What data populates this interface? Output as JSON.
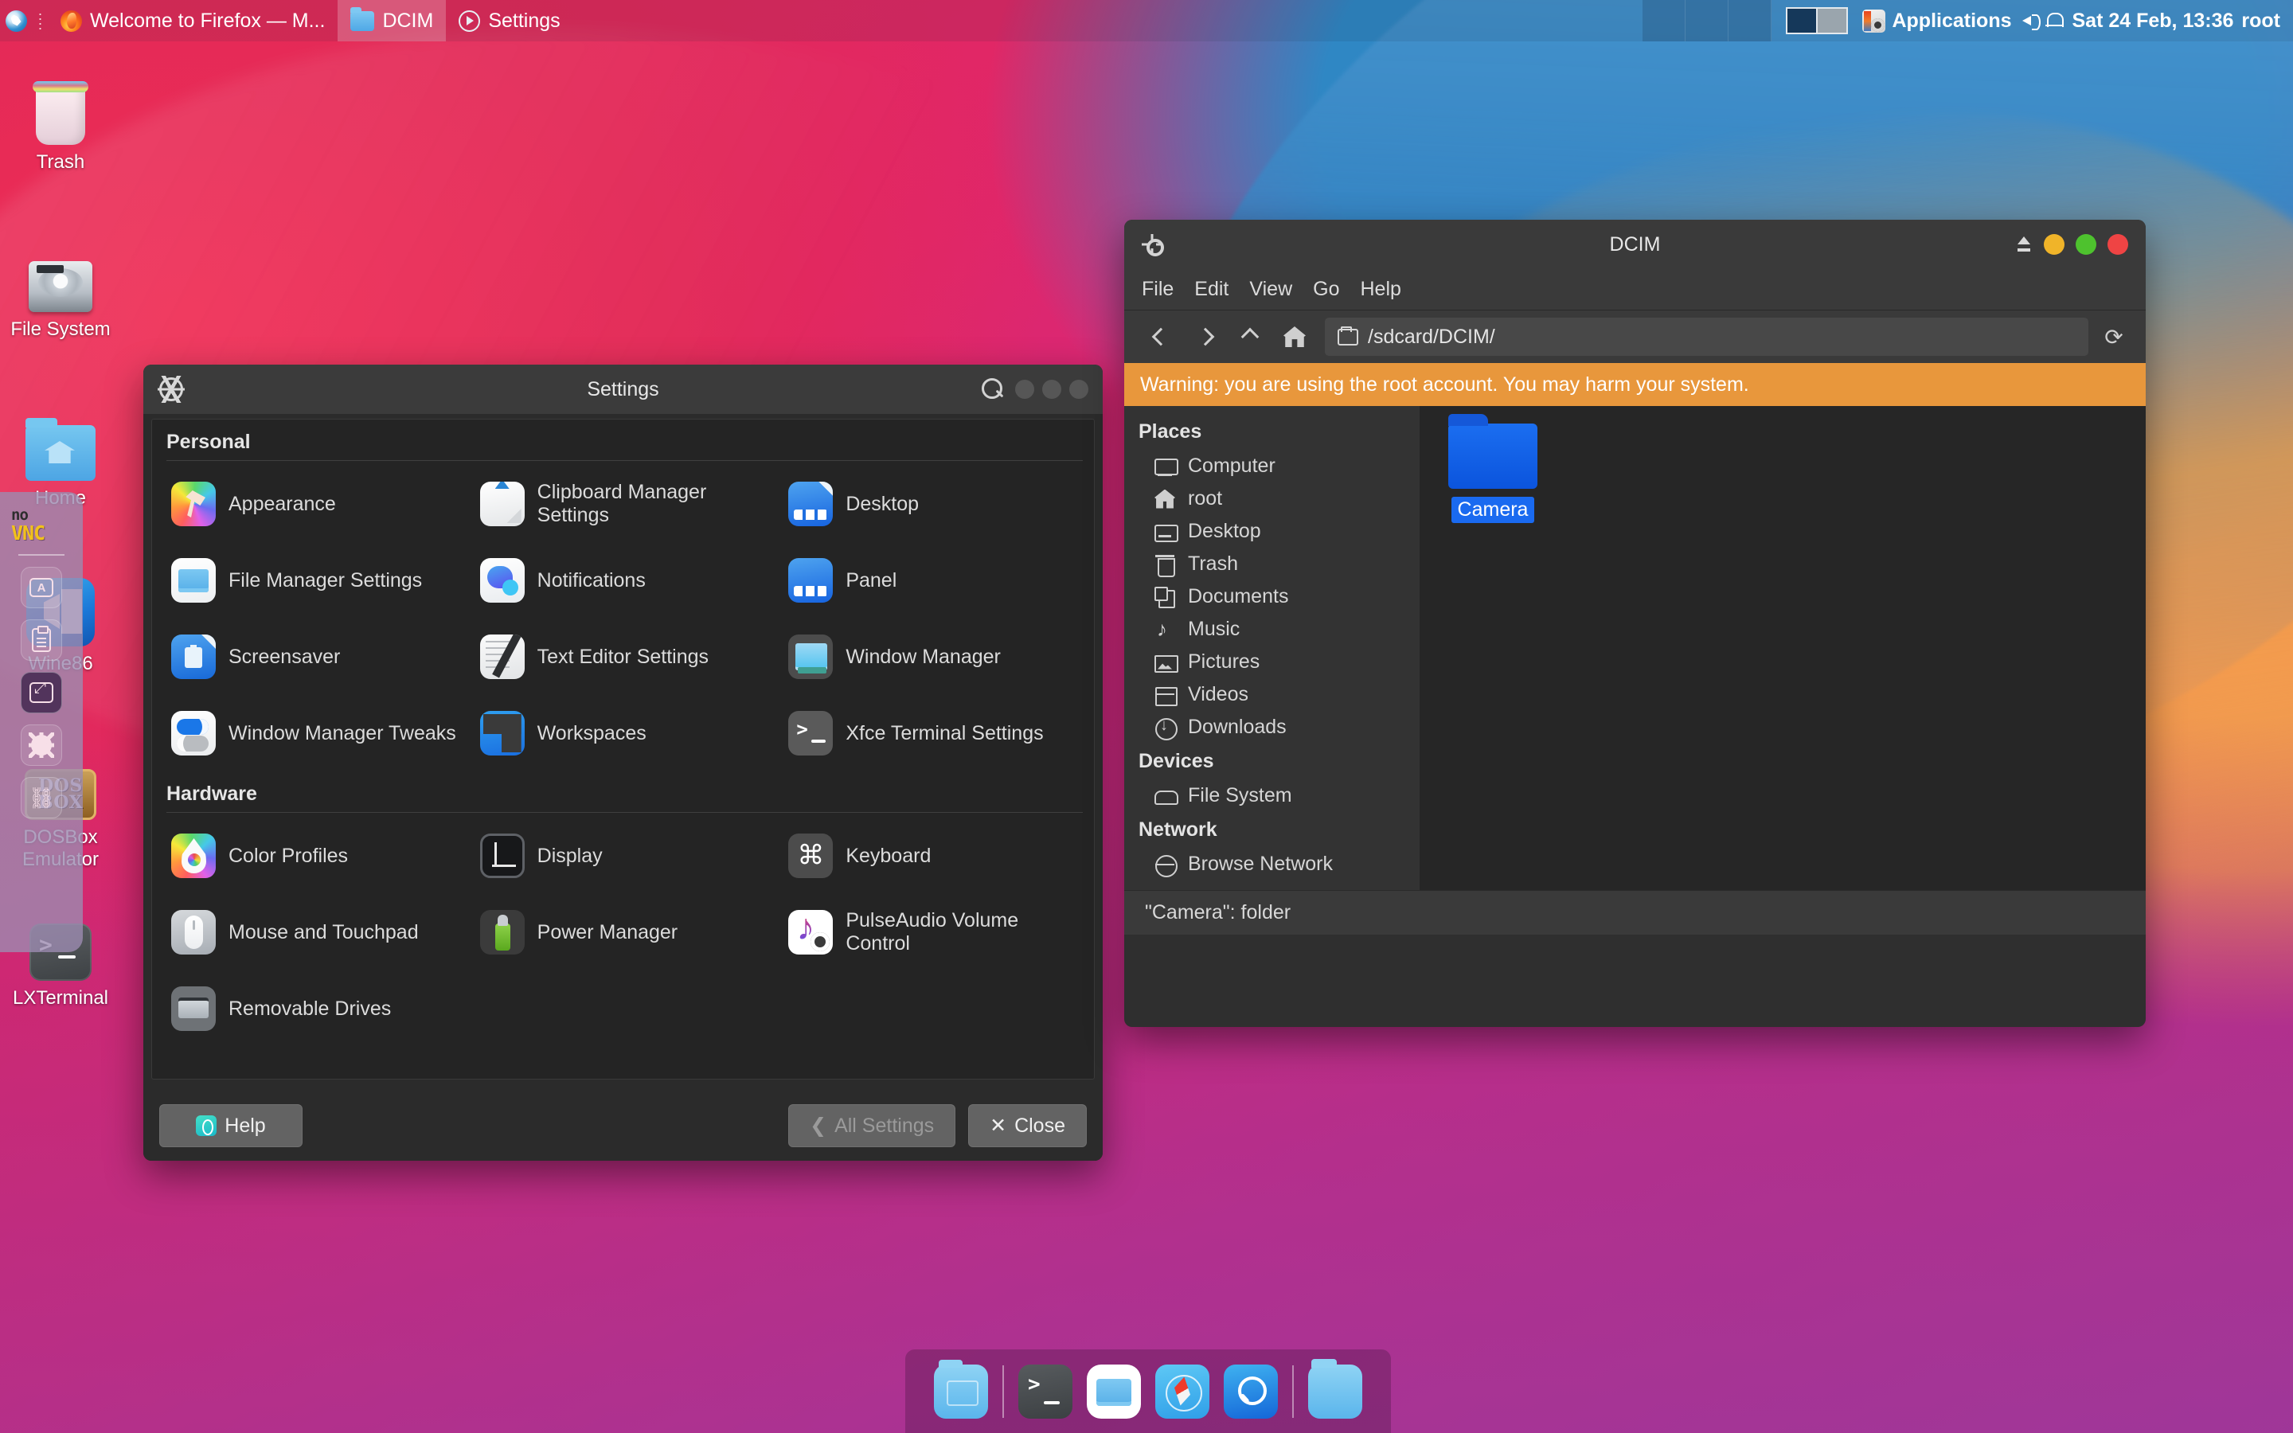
{
  "panel": {
    "whisker_icon": "xfce-whisker-menu-icon",
    "grip_icon": "panel-grip-icon",
    "tasks": [
      {
        "label": "Welcome to Firefox — M...",
        "icon": "firefox-icon",
        "active": false
      },
      {
        "label": "DCIM",
        "icon": "folder-icon",
        "active": true
      },
      {
        "label": "Settings",
        "icon": "settings-icon",
        "active": false
      }
    ],
    "applications_label": "Applications",
    "applications_icon": "applications-menu-icon",
    "volume_icon": "volume-icon",
    "notification_icon": "bell-icon",
    "clock": "Sat 24 Feb, 13:36",
    "user": "root"
  },
  "desktop_icons": [
    {
      "label": "Trash",
      "icon": "trash-icon"
    },
    {
      "label": "File System",
      "icon": "hard-drive-icon"
    },
    {
      "label": "Home",
      "icon": "home-folder-icon"
    },
    {
      "label": "Wine86",
      "icon": "wine-icon"
    },
    {
      "label": "DOSBox Emulator",
      "icon": "dosbox-icon"
    },
    {
      "label": "LXTerminal",
      "icon": "terminal-icon"
    }
  ],
  "novnc": {
    "logo_top": "no",
    "logo_bottom": "VNC",
    "buttons": [
      {
        "name": "keyboard-button",
        "icon": "keyboard-icon"
      },
      {
        "name": "clipboard-button",
        "icon": "clipboard-icon"
      },
      {
        "name": "fullscreen-button",
        "icon": "expand-icon"
      },
      {
        "name": "settings-button",
        "icon": "gear-icon"
      },
      {
        "name": "disconnect-button",
        "icon": "unlink-icon"
      }
    ]
  },
  "settings_window": {
    "title": "Settings",
    "gear_icon": "settings-gear-icon",
    "search_icon": "search-icon",
    "sections": [
      {
        "title": "Personal",
        "items": [
          {
            "label": "Appearance",
            "icon": "appearance-icon",
            "style": "i-appearance"
          },
          {
            "label": "Clipboard Manager Settings",
            "icon": "clipboard-manager-icon",
            "style": "i-clipboard"
          },
          {
            "label": "Desktop",
            "icon": "desktop-icon",
            "style": "i-desktop"
          },
          {
            "label": "File Manager Settings",
            "icon": "file-manager-icon",
            "style": "i-filemgr"
          },
          {
            "label": "Notifications",
            "icon": "notifications-icon",
            "style": "i-notif"
          },
          {
            "label": "Panel",
            "icon": "panel-icon",
            "style": "i-panel"
          },
          {
            "label": "Screensaver",
            "icon": "screensaver-icon",
            "style": "i-screensaver"
          },
          {
            "label": "Text Editor Settings",
            "icon": "text-editor-icon",
            "style": "i-texted"
          },
          {
            "label": "Window Manager",
            "icon": "window-manager-icon",
            "style": "i-winmgr"
          },
          {
            "label": "Window Manager Tweaks",
            "icon": "window-manager-tweaks-icon",
            "style": "i-wmtweaks"
          },
          {
            "label": "Workspaces",
            "icon": "workspaces-icon",
            "style": "i-workspaces"
          },
          {
            "label": "Xfce Terminal Settings",
            "icon": "xfce-terminal-icon",
            "style": "i-xfceterm"
          }
        ]
      },
      {
        "title": "Hardware",
        "items": [
          {
            "label": "Color Profiles",
            "icon": "color-profiles-icon",
            "style": "i-colorprof"
          },
          {
            "label": "Display",
            "icon": "display-icon",
            "style": "i-display"
          },
          {
            "label": "Keyboard",
            "icon": "keyboard-icon",
            "style": "i-keyboard"
          },
          {
            "label": "Mouse and Touchpad",
            "icon": "mouse-icon",
            "style": "i-mouse"
          },
          {
            "label": "Power Manager",
            "icon": "power-manager-icon",
            "style": "i-power"
          },
          {
            "label": "PulseAudio Volume Control",
            "icon": "pulseaudio-icon",
            "style": "i-pulse"
          },
          {
            "label": "Removable Drives",
            "icon": "removable-drives-icon",
            "style": "i-removable"
          }
        ]
      }
    ],
    "footer": {
      "help_label": "Help",
      "help_icon": "help-icon",
      "all_settings_label": "All Settings",
      "close_label": "Close"
    }
  },
  "dcim_window": {
    "title": "DCIM",
    "gear_icon": "window-gear-icon",
    "eject_icon": "eject-icon",
    "menu": [
      "File",
      "Edit",
      "View",
      "Go",
      "Help"
    ],
    "toolbar": {
      "back_icon": "back-icon",
      "forward_icon": "forward-icon",
      "up_icon": "up-icon",
      "home_icon": "home-icon",
      "path_icon": "folder-icon",
      "path": "/sdcard/DCIM/",
      "reload_icon": "reload-icon"
    },
    "warning": "Warning: you are using the root account. You may harm your system.",
    "sidebar": [
      {
        "heading": "Places",
        "items": [
          {
            "label": "Computer",
            "icon": "computer-icon",
            "cls": "pli-computer"
          },
          {
            "label": "root",
            "icon": "home-icon",
            "cls": "pli-home"
          },
          {
            "label": "Desktop",
            "icon": "desktop-icon",
            "cls": "pli-desktop"
          },
          {
            "label": "Trash",
            "icon": "trash-icon",
            "cls": "pli-trash"
          },
          {
            "label": "Documents",
            "icon": "documents-icon",
            "cls": "pli-docs"
          },
          {
            "label": "Music",
            "icon": "music-icon",
            "cls": "pli-music"
          },
          {
            "label": "Pictures",
            "icon": "pictures-icon",
            "cls": "pli-pics"
          },
          {
            "label": "Videos",
            "icon": "videos-icon",
            "cls": "pli-videos"
          },
          {
            "label": "Downloads",
            "icon": "downloads-icon",
            "cls": "pli-dl"
          }
        ]
      },
      {
        "heading": "Devices",
        "items": [
          {
            "label": "File System",
            "icon": "drive-icon",
            "cls": "pli-fs"
          }
        ]
      },
      {
        "heading": "Network",
        "items": [
          {
            "label": "Browse Network",
            "icon": "network-icon",
            "cls": "pli-net"
          }
        ]
      }
    ],
    "files": [
      {
        "label": "Camera",
        "icon": "folder-icon",
        "selected": true
      }
    ],
    "status": "\"Camera\": folder"
  },
  "dock": {
    "items": [
      {
        "name": "dock-item-file-manager",
        "icon": "folder-icon",
        "cls": "dk-folder1"
      },
      {
        "name": "dock-separator-1",
        "icon": "separator",
        "cls": "sep"
      },
      {
        "name": "dock-item-terminal",
        "icon": "terminal-icon",
        "cls": "dk-term"
      },
      {
        "name": "dock-item-files",
        "icon": "files-icon",
        "cls": "dk-files"
      },
      {
        "name": "dock-item-browser",
        "icon": "compass-icon",
        "cls": "dk-safari"
      },
      {
        "name": "dock-item-search",
        "icon": "search-icon",
        "cls": "dk-search"
      },
      {
        "name": "dock-separator-2",
        "icon": "separator",
        "cls": "sep"
      },
      {
        "name": "dock-item-folder",
        "icon": "folder-icon",
        "cls": "dk-folder2"
      }
    ]
  },
  "colors": {
    "accent_blue": "#1a6af0",
    "warning_orange": "#e8973c",
    "close_red": "#ef4444",
    "maximize_green": "#4ec22e",
    "minimize_yellow": "#f0b429"
  }
}
